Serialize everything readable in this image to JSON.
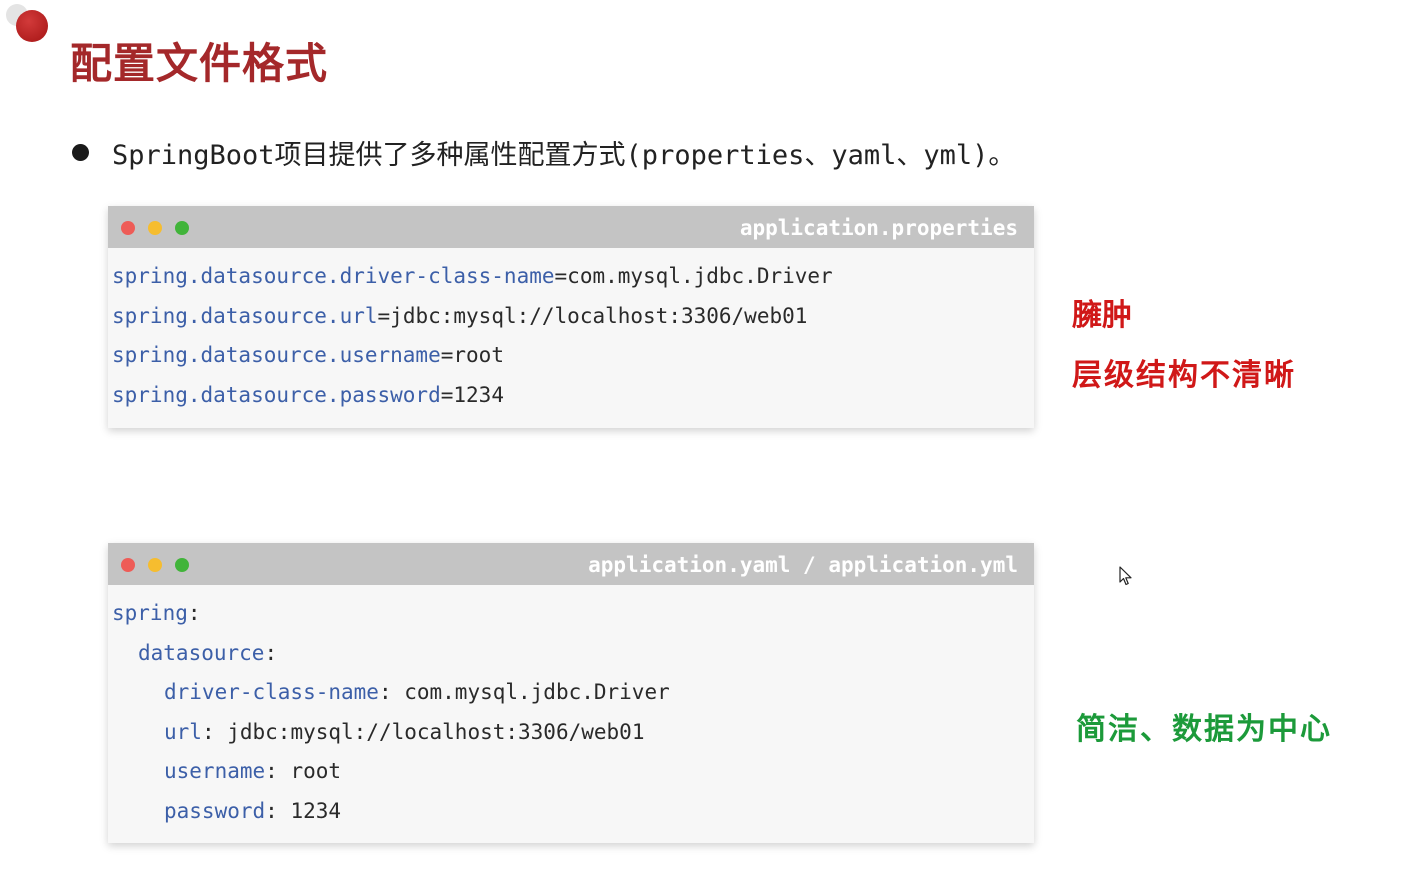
{
  "slide": {
    "title": "配置文件格式",
    "bullet": "SpringBoot项目提供了多种属性配置方式(properties、yaml、yml)。"
  },
  "properties_window": {
    "filename": "application.properties",
    "lines": [
      {
        "key": "spring.datasource.driver-class-name",
        "sep": "=",
        "value": "com.mysql.jdbc.Driver"
      },
      {
        "key": "spring.datasource.url",
        "sep": "=",
        "value": "jdbc:mysql://localhost:3306/web01"
      },
      {
        "key": "spring.datasource.username",
        "sep": "=",
        "value": "root"
      },
      {
        "key": "spring.datasource.password",
        "sep": "=",
        "value": "1234"
      }
    ]
  },
  "yaml_window": {
    "filename": "application.yaml / application.yml",
    "lines": [
      {
        "key": "spring",
        "sep": ":",
        "value": ""
      },
      {
        "key": "datasource",
        "sep": ":",
        "value": ""
      },
      {
        "key": "driver-class-name",
        "sep": ": ",
        "value": "com.mysql.jdbc.Driver"
      },
      {
        "key": "url",
        "sep": ": ",
        "value": "jdbc:mysql://localhost:3306/web01"
      },
      {
        "key": "username",
        "sep": ": ",
        "value": "root"
      },
      {
        "key": "password",
        "sep": ": ",
        "value": "1234"
      }
    ]
  },
  "annotations": {
    "properties_note_1": "臃肿",
    "properties_note_2": "层级结构不清晰",
    "yaml_note": "简洁、数据为中心"
  },
  "colors": {
    "title": "#a4282a",
    "key": "#3c5fa8",
    "window_header": "#c4c4c4",
    "note_red": "#d01818",
    "note_green": "#1c9a3a"
  }
}
